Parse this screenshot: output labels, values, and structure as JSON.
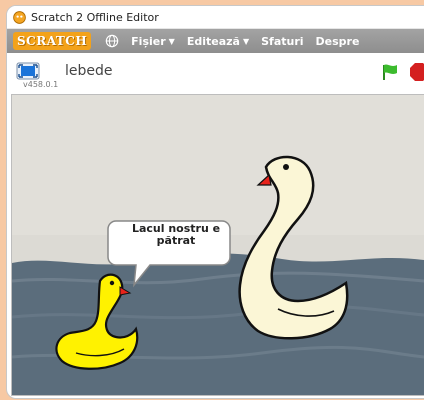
{
  "window": {
    "title": "Scratch 2 Offline Editor"
  },
  "menubar": {
    "logo": "SCRATCH",
    "items": [
      {
        "label": "Fișier",
        "has_caret": true
      },
      {
        "label": "Editează",
        "has_caret": true
      },
      {
        "label": "Sfaturi",
        "has_caret": false
      },
      {
        "label": "Despre",
        "has_caret": false
      }
    ],
    "caret": "▼"
  },
  "stagebar": {
    "project_name": "lebede",
    "version": "v458.0.1"
  },
  "stage": {
    "speech_bubble": "Lacul nostru e pătrat"
  },
  "colors": {
    "menubar": "#999999",
    "logo": "#f3a21a",
    "green_flag": "#3cbb2e",
    "stop": "#d42020",
    "water": "#5b6d7c",
    "sky": "#dcdad4",
    "big_swan": "#fbf6d6",
    "small_duck": "#fff200",
    "beak": "#e8231b"
  },
  "icons": {
    "app": "scratch-cat-icon",
    "globe": "globe-icon",
    "fullscreen": "fullscreen-icon",
    "flag": "green-flag-icon",
    "stop": "stop-icon"
  }
}
